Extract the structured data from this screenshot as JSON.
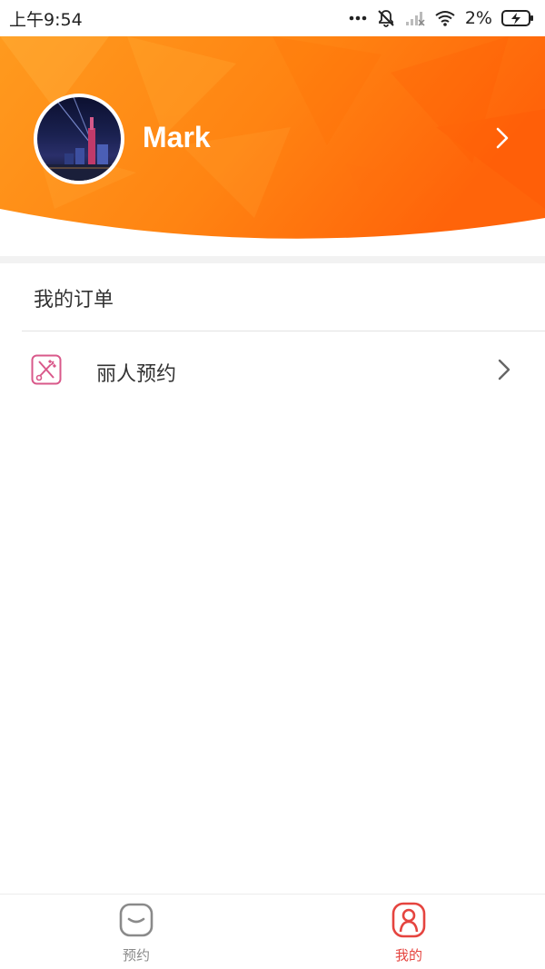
{
  "status_bar": {
    "time": "上午9:54",
    "battery": "2%",
    "icons": [
      "more-dots-icon",
      "mute-icon",
      "signal-icon",
      "wifi-icon",
      "battery-charging-icon"
    ]
  },
  "profile": {
    "name": "Mark",
    "header_color": "#ff7a12"
  },
  "orders": {
    "title": "我的订单",
    "items": [
      {
        "label": "丽人预约",
        "icon": "scissors-comb-icon",
        "icon_color": "#d9588a"
      }
    ]
  },
  "bottom_nav": {
    "items": [
      {
        "label": "预约",
        "icon": "booking-face-icon",
        "active": false
      },
      {
        "label": "我的",
        "icon": "profile-icon",
        "active": true
      }
    ],
    "active_color": "#e5443f",
    "inactive_color": "#8a8a8a"
  }
}
